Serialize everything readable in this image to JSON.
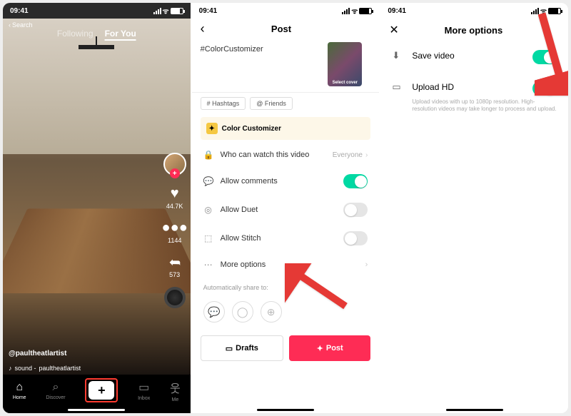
{
  "statusBar": {
    "time": "09:41",
    "searchLabel": "Search"
  },
  "feed": {
    "tabFollowing": "Following",
    "tabForYou": "For You",
    "likes": "44.7K",
    "comments": "1144",
    "shares": "573",
    "username": "@paultheatlartist",
    "soundPrefix": "sound - ",
    "soundName": "paultheatlartist",
    "nav": {
      "home": "Home",
      "discover": "Discover",
      "inbox": "Inbox",
      "me": "Me"
    }
  },
  "post": {
    "title": "Post",
    "hashtag": "#ColorCustomizer",
    "coverLabel": "Select cover",
    "chipHashtags": "# Hashtags",
    "chipFriends": "@ Friends",
    "colorCustomizer": "Color Customizer",
    "whoCanWatch": "Who can watch this video",
    "whoCanWatchValue": "Everyone",
    "allowComments": "Allow comments",
    "allowDuet": "Allow Duet",
    "allowStitch": "Allow Stitch",
    "moreOptions": "More options",
    "autoShare": "Automatically share to:",
    "drafts": "Drafts",
    "postBtn": "Post"
  },
  "moreOptions": {
    "title": "More options",
    "saveVideo": "Save video",
    "uploadHD": "Upload HD",
    "uploadDesc": "Upload videos with up to 1080p resolution. High-resolution videos may take longer to process and upload."
  }
}
